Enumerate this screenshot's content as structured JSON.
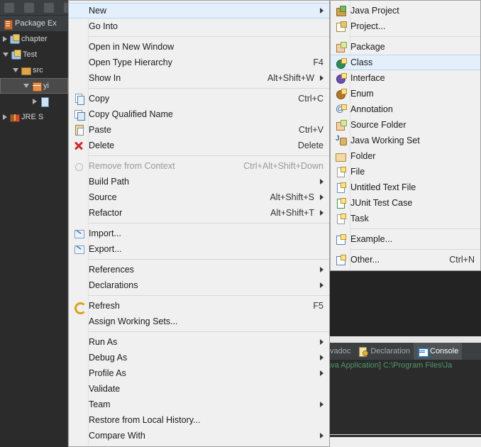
{
  "workbench": {
    "package_explorer": {
      "title": "Package Ex",
      "icon": "package-explorer-icon",
      "tree": [
        {
          "label": "chapter",
          "icon": "java-project-icon",
          "state": "collapsed",
          "indent": 0,
          "selected": false
        },
        {
          "label": "Test",
          "icon": "java-project-icon",
          "state": "expanded",
          "indent": 0,
          "selected": false
        },
        {
          "label": "src",
          "icon": "source-folder-icon",
          "state": "expanded",
          "indent": 1,
          "selected": false
        },
        {
          "label": "yi",
          "icon": "package-icon",
          "state": "expanded",
          "indent": 2,
          "selected": true
        },
        {
          "label": "",
          "icon": "java-file-icon",
          "state": "collapsed",
          "indent": 3,
          "selected": false
        },
        {
          "label": "JRE S",
          "icon": "jre-library-icon",
          "state": "collapsed",
          "indent": 0,
          "selected": false
        }
      ]
    },
    "console": {
      "tabs": [
        {
          "label": "vadoc",
          "icon": "javadoc-icon",
          "active": false
        },
        {
          "label": "Declaration",
          "icon": "declaration-icon",
          "active": false
        },
        {
          "label": "Console",
          "icon": "console-icon",
          "active": true
        }
      ],
      "output_line": "ava Application] C:\\Program Files\\Ja"
    }
  },
  "context_menu": {
    "name": "package-explorer-context-menu",
    "items": [
      {
        "label": "New",
        "accel": "",
        "icon": "",
        "submenu": true,
        "highlighted": true,
        "disabled": false
      },
      {
        "label": "Go Into",
        "accel": "",
        "icon": "",
        "submenu": false,
        "highlighted": false,
        "disabled": false
      },
      {
        "separator": true
      },
      {
        "label": "Open in New Window",
        "accel": "",
        "icon": "",
        "submenu": false,
        "highlighted": false,
        "disabled": false
      },
      {
        "label": "Open Type Hierarchy",
        "accel": "F4",
        "icon": "",
        "submenu": false,
        "highlighted": false,
        "disabled": false
      },
      {
        "label": "Show In",
        "accel": "Alt+Shift+W",
        "icon": "",
        "submenu": true,
        "highlighted": false,
        "disabled": false
      },
      {
        "separator": true
      },
      {
        "label": "Copy",
        "accel": "Ctrl+C",
        "icon": "copy",
        "submenu": false,
        "highlighted": false,
        "disabled": false
      },
      {
        "label": "Copy Qualified Name",
        "accel": "",
        "icon": "copyq",
        "submenu": false,
        "highlighted": false,
        "disabled": false
      },
      {
        "label": "Paste",
        "accel": "Ctrl+V",
        "icon": "paste",
        "submenu": false,
        "highlighted": false,
        "disabled": false
      },
      {
        "label": "Delete",
        "accel": "Delete",
        "icon": "del",
        "submenu": false,
        "highlighted": false,
        "disabled": false
      },
      {
        "separator": true
      },
      {
        "label": "Remove from Context",
        "accel": "Ctrl+Alt+Shift+Down",
        "icon": "ctxrm",
        "submenu": false,
        "highlighted": false,
        "disabled": true
      },
      {
        "label": "Build Path",
        "accel": "",
        "icon": "",
        "submenu": true,
        "highlighted": false,
        "disabled": false
      },
      {
        "label": "Source",
        "accel": "Alt+Shift+S",
        "icon": "",
        "submenu": true,
        "highlighted": false,
        "disabled": false
      },
      {
        "label": "Refactor",
        "accel": "Alt+Shift+T",
        "icon": "",
        "submenu": true,
        "highlighted": false,
        "disabled": false
      },
      {
        "separator": true
      },
      {
        "label": "Import...",
        "accel": "",
        "icon": "imp",
        "submenu": false,
        "highlighted": false,
        "disabled": false
      },
      {
        "label": "Export...",
        "accel": "",
        "icon": "imp",
        "submenu": false,
        "highlighted": false,
        "disabled": false
      },
      {
        "separator": true
      },
      {
        "label": "References",
        "accel": "",
        "icon": "",
        "submenu": true,
        "highlighted": false,
        "disabled": false
      },
      {
        "label": "Declarations",
        "accel": "",
        "icon": "",
        "submenu": true,
        "highlighted": false,
        "disabled": false
      },
      {
        "separator": true
      },
      {
        "label": "Refresh",
        "accel": "F5",
        "icon": "refresh",
        "submenu": false,
        "highlighted": false,
        "disabled": false
      },
      {
        "label": "Assign Working Sets...",
        "accel": "",
        "icon": "",
        "submenu": false,
        "highlighted": false,
        "disabled": false
      },
      {
        "separator": true
      },
      {
        "label": "Run As",
        "accel": "",
        "icon": "",
        "submenu": true,
        "highlighted": false,
        "disabled": false
      },
      {
        "label": "Debug As",
        "accel": "",
        "icon": "",
        "submenu": true,
        "highlighted": false,
        "disabled": false
      },
      {
        "label": "Profile As",
        "accel": "",
        "icon": "",
        "submenu": true,
        "highlighted": false,
        "disabled": false
      },
      {
        "label": "Validate",
        "accel": "",
        "icon": "",
        "submenu": false,
        "highlighted": false,
        "disabled": false
      },
      {
        "label": "Team",
        "accel": "",
        "icon": "",
        "submenu": true,
        "highlighted": false,
        "disabled": false
      },
      {
        "label": "Restore from Local History...",
        "accel": "",
        "icon": "",
        "submenu": false,
        "highlighted": false,
        "disabled": false
      },
      {
        "label": "Compare With",
        "accel": "",
        "icon": "",
        "submenu": true,
        "highlighted": false,
        "disabled": false
      }
    ]
  },
  "new_submenu": {
    "name": "new-submenu",
    "items": [
      {
        "label": "Java Project",
        "accel": "",
        "icon": "jproj",
        "highlighted": false
      },
      {
        "label": "Project...",
        "accel": "",
        "icon": "proj",
        "highlighted": false
      },
      {
        "separator": true
      },
      {
        "label": "Package",
        "accel": "",
        "icon": "pkg",
        "highlighted": false
      },
      {
        "label": "Class",
        "accel": "",
        "icon": "cls",
        "highlighted": true
      },
      {
        "label": "Interface",
        "accel": "",
        "icon": "iface",
        "highlighted": false
      },
      {
        "label": "Enum",
        "accel": "",
        "icon": "enm",
        "highlighted": false
      },
      {
        "label": "Annotation",
        "accel": "",
        "icon": "ann",
        "highlighted": false
      },
      {
        "label": "Source Folder",
        "accel": "",
        "icon": "srcf",
        "highlighted": false
      },
      {
        "label": "Java Working Set",
        "accel": "",
        "icon": "jws",
        "highlighted": false
      },
      {
        "label": "Folder",
        "accel": "",
        "icon": "fld",
        "highlighted": false
      },
      {
        "label": "File",
        "accel": "",
        "icon": "file",
        "highlighted": false
      },
      {
        "label": "Untitled Text File",
        "accel": "",
        "icon": "txtf",
        "highlighted": false
      },
      {
        "label": "JUnit Test Case",
        "accel": "",
        "icon": "junit",
        "highlighted": false
      },
      {
        "label": "Task",
        "accel": "",
        "icon": "task",
        "highlighted": false
      },
      {
        "separator": true
      },
      {
        "label": "Example...",
        "accel": "",
        "icon": "exm",
        "highlighted": false
      },
      {
        "separator": true
      },
      {
        "label": "Other...",
        "accel": "Ctrl+N",
        "icon": "oth",
        "highlighted": false
      }
    ]
  },
  "colors": {
    "menu_bg": "#f0f0f0",
    "menu_highlight": "#e3effb",
    "ide_dark": "#2b2b2b",
    "ide_panel": "#3c3f41",
    "console_text": "#4e9a6a"
  }
}
